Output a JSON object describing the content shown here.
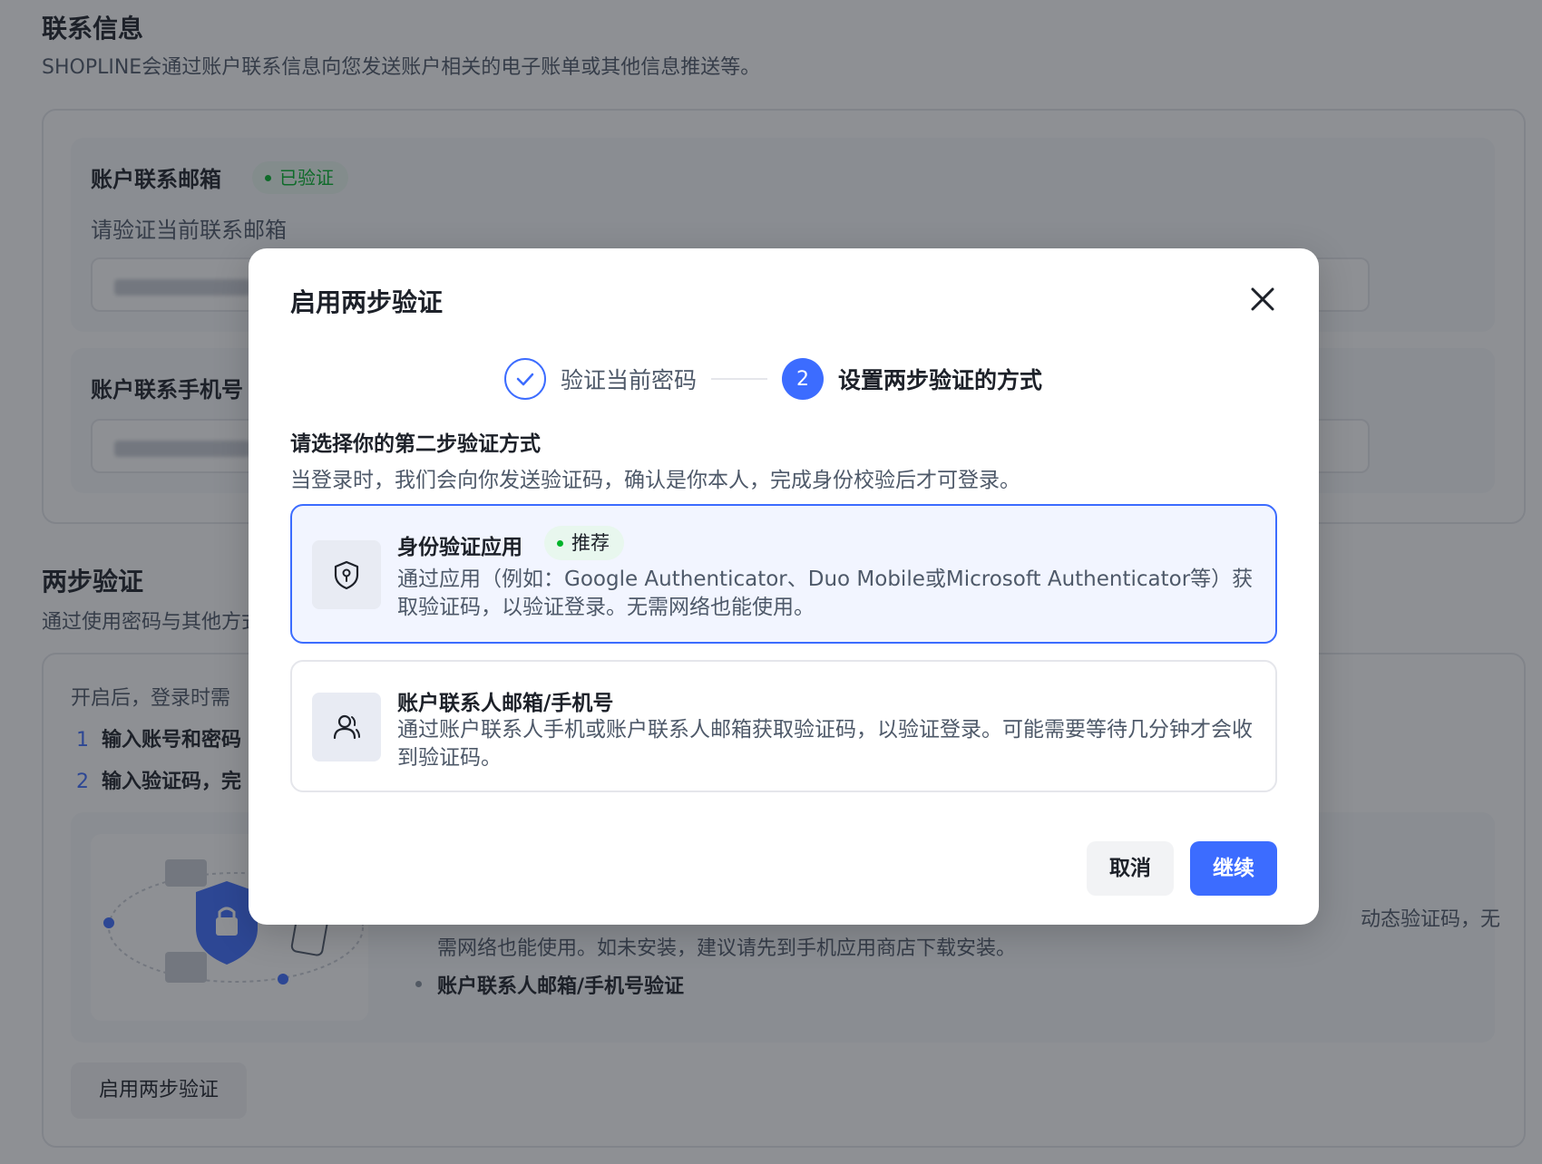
{
  "background": {
    "contact_section": {
      "title": "联系信息",
      "desc": "SHOPLINE会通过账户联系信息向您发送账户相关的电子账单或其他信息推送等。",
      "email": {
        "label": "账户联系邮箱",
        "status_tag": "已验证",
        "hint": "请验证当前联系邮箱"
      },
      "phone": {
        "label": "账户联系手机号"
      }
    },
    "two_step_section": {
      "title": "两步验证",
      "desc": "通过使用密码与其他方式",
      "intro": "开启后，登录时需",
      "steps": [
        {
          "num": "1",
          "text": "输入账号和密码"
        },
        {
          "num": "2",
          "text": "输入验证码，完"
        }
      ],
      "para_line1_right": "动态验证码，无",
      "para_line2": "需网络也能使用。如未安装，建议请先到手机应用商店下载安装。",
      "bullet": "账户联系人邮箱/手机号验证",
      "enable_button": "启用两步验证"
    }
  },
  "modal": {
    "title": "启用两步验证",
    "steps": [
      {
        "label": "验证当前密码",
        "status": "done"
      },
      {
        "number": "2",
        "label": "设置两步验证的方式",
        "status": "current"
      }
    ],
    "section_label": "请选择你的第二步验证方式",
    "section_desc": "当登录时，我们会向你发送验证码，确认是你本人，完成身份校验后才可登录。",
    "options": [
      {
        "title": "身份验证应用",
        "tag": "推荐",
        "desc": "通过应用（例如：Google Authenticator、Duo Mobile或Microsoft Authenticator等）获取验证码，以验证登录。无需网络也能使用。",
        "icon": "shield-key-icon",
        "selected": true
      },
      {
        "title": "账户联系人邮箱/手机号",
        "desc": "通过账户联系人手机或账户联系人邮箱获取验证码，以验证登录。可能需要等待几分钟才会收到验证码。",
        "icon": "user-icon",
        "selected": false
      }
    ],
    "cancel_label": "取消",
    "continue_label": "继续"
  },
  "colors": {
    "primary": "#3c6cff",
    "success": "#00b42a",
    "overlay": "rgba(29,33,41,0.5)"
  }
}
